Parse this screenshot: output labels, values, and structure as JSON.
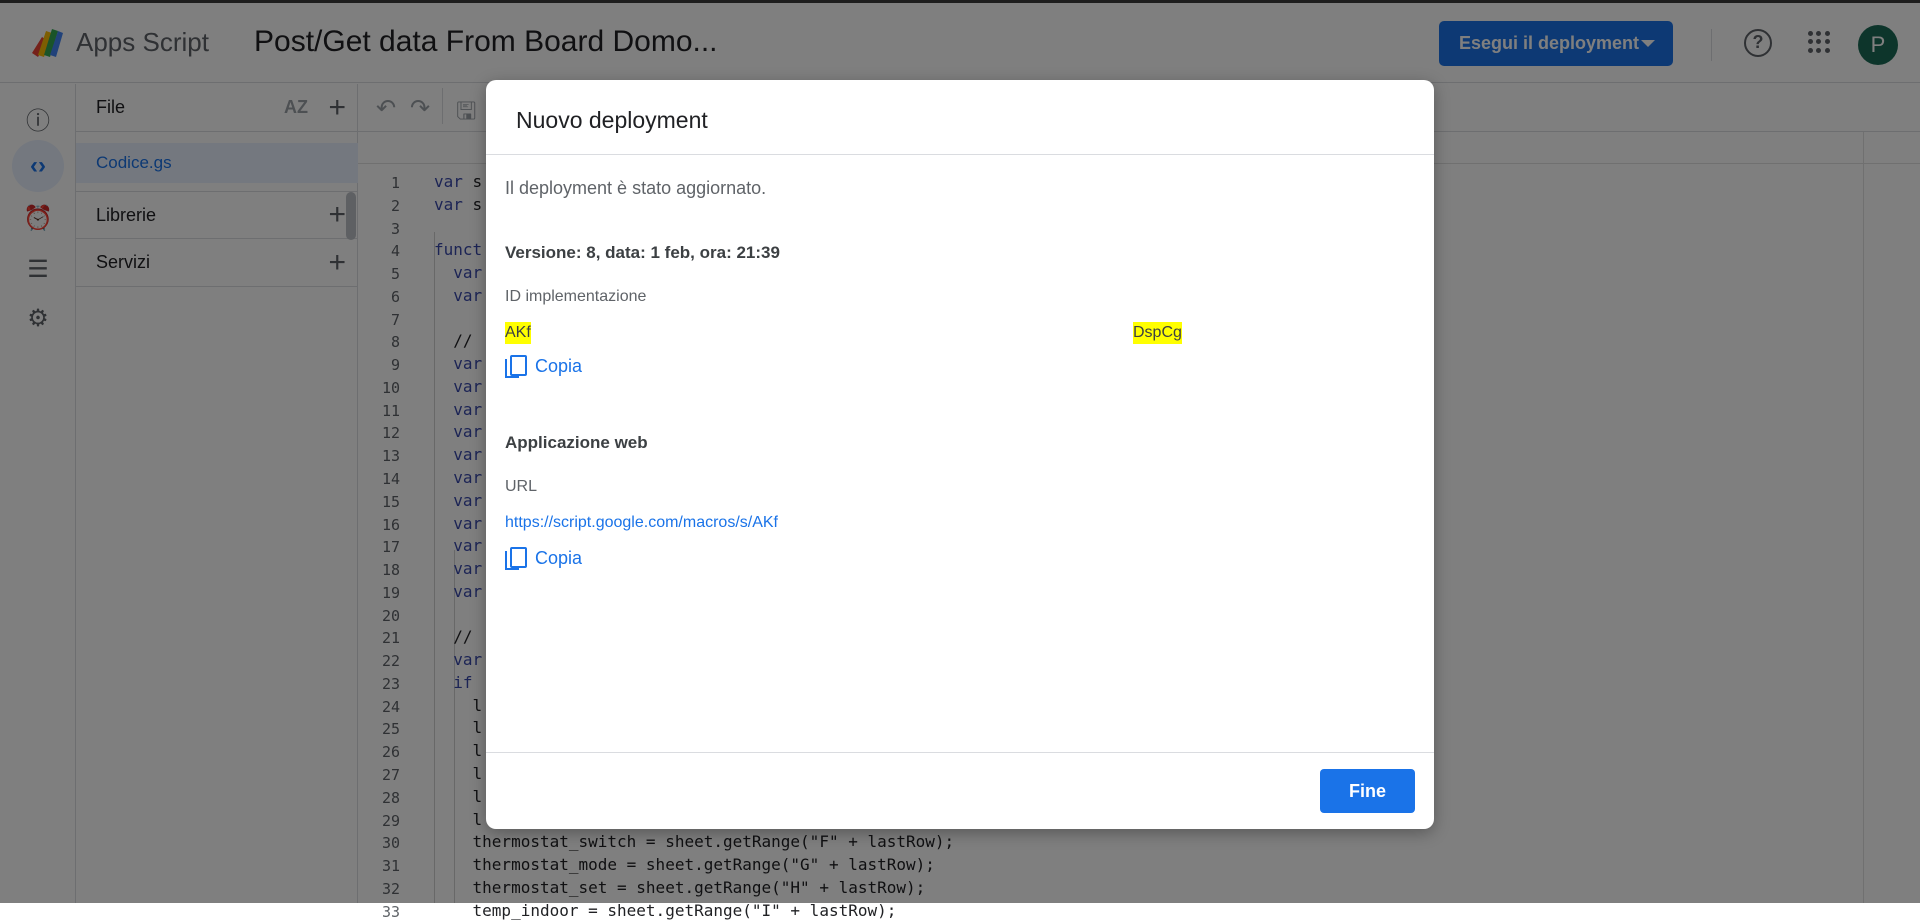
{
  "header": {
    "app_name": "Apps Script",
    "project_title": "Post/Get data From Board Domo...",
    "deploy_button": "Esegui il deployment",
    "help_icon": "?",
    "avatar_letter": "P",
    "avatar_color": "#1b6b56",
    "accent_color": "#1a73e8"
  },
  "rail": {
    "icons": [
      "info-icon",
      "code-icon",
      "alarm-clock-icon",
      "executions-icon",
      "gear-icon"
    ]
  },
  "files": {
    "title": "File",
    "sort_icon": "AZ",
    "selected_file": "Codice.gs",
    "libraries": "Librerie",
    "services": "Servizi"
  },
  "editor": {
    "lines": [
      {
        "n": "1",
        "kw": "var",
        "rest": " s"
      },
      {
        "n": "2",
        "kw": "var",
        "rest": " s"
      },
      {
        "n": "3",
        "kw": "",
        "rest": ""
      },
      {
        "n": "4",
        "kw": "funct",
        "rest": ""
      },
      {
        "n": "5",
        "kw": "  var",
        "rest": ""
      },
      {
        "n": "6",
        "kw": "  var",
        "rest": ""
      },
      {
        "n": "7",
        "kw": "",
        "rest": ""
      },
      {
        "n": "8",
        "kw": "",
        "rest": "  // "
      },
      {
        "n": "9",
        "kw": "  var",
        "rest": ""
      },
      {
        "n": "10",
        "kw": "  var",
        "rest": ""
      },
      {
        "n": "11",
        "kw": "  var",
        "rest": ""
      },
      {
        "n": "12",
        "kw": "  var",
        "rest": ""
      },
      {
        "n": "13",
        "kw": "  var",
        "rest": ""
      },
      {
        "n": "14",
        "kw": "  var",
        "rest": ""
      },
      {
        "n": "15",
        "kw": "  var",
        "rest": ""
      },
      {
        "n": "16",
        "kw": "  var",
        "rest": ""
      },
      {
        "n": "17",
        "kw": "  var",
        "rest": ""
      },
      {
        "n": "18",
        "kw": "  var",
        "rest": ""
      },
      {
        "n": "19",
        "kw": "  var",
        "rest": ""
      },
      {
        "n": "20",
        "kw": "",
        "rest": ""
      },
      {
        "n": "21",
        "kw": "",
        "rest": "  // "
      },
      {
        "n": "22",
        "kw": "  var",
        "rest": ""
      },
      {
        "n": "23",
        "kw": "  if",
        "rest": ""
      },
      {
        "n": "24",
        "kw": "",
        "rest": "    l"
      },
      {
        "n": "25",
        "kw": "",
        "rest": "    l"
      },
      {
        "n": "26",
        "kw": "",
        "rest": "    l"
      },
      {
        "n": "27",
        "kw": "",
        "rest": "    l"
      },
      {
        "n": "28",
        "kw": "",
        "rest": "    l"
      },
      {
        "n": "29",
        "kw": "",
        "rest": "    l"
      },
      {
        "n": "30",
        "kw": "",
        "rest": "    thermostat_switch = sheet.getRange(\"F\" + lastRow);"
      },
      {
        "n": "31",
        "kw": "",
        "rest": "    thermostat_mode = sheet.getRange(\"G\" + lastRow);"
      },
      {
        "n": "32",
        "kw": "",
        "rest": "    thermostat_set = sheet.getRange(\"H\" + lastRow);"
      },
      {
        "n": "33",
        "kw": "",
        "rest": "    temp_indoor = sheet.getRange(\"I\" + lastRow);"
      }
    ]
  },
  "dialog": {
    "title": "Nuovo deployment",
    "message": "Il deployment è stato aggiornato.",
    "version": "Versione: 8, data: 1 feb, ora: 21:39",
    "id_label": "ID implementazione",
    "id_start": "AKf",
    "id_end": "DspCg",
    "copy_label": "Copia",
    "webapp_title": "Applicazione web",
    "url_label": "URL",
    "url_value": "https://script.google.com/macros/s/AKf",
    "copy_label_2": "Copia",
    "done_button": "Fine",
    "highlight_color": "#ffff00"
  }
}
